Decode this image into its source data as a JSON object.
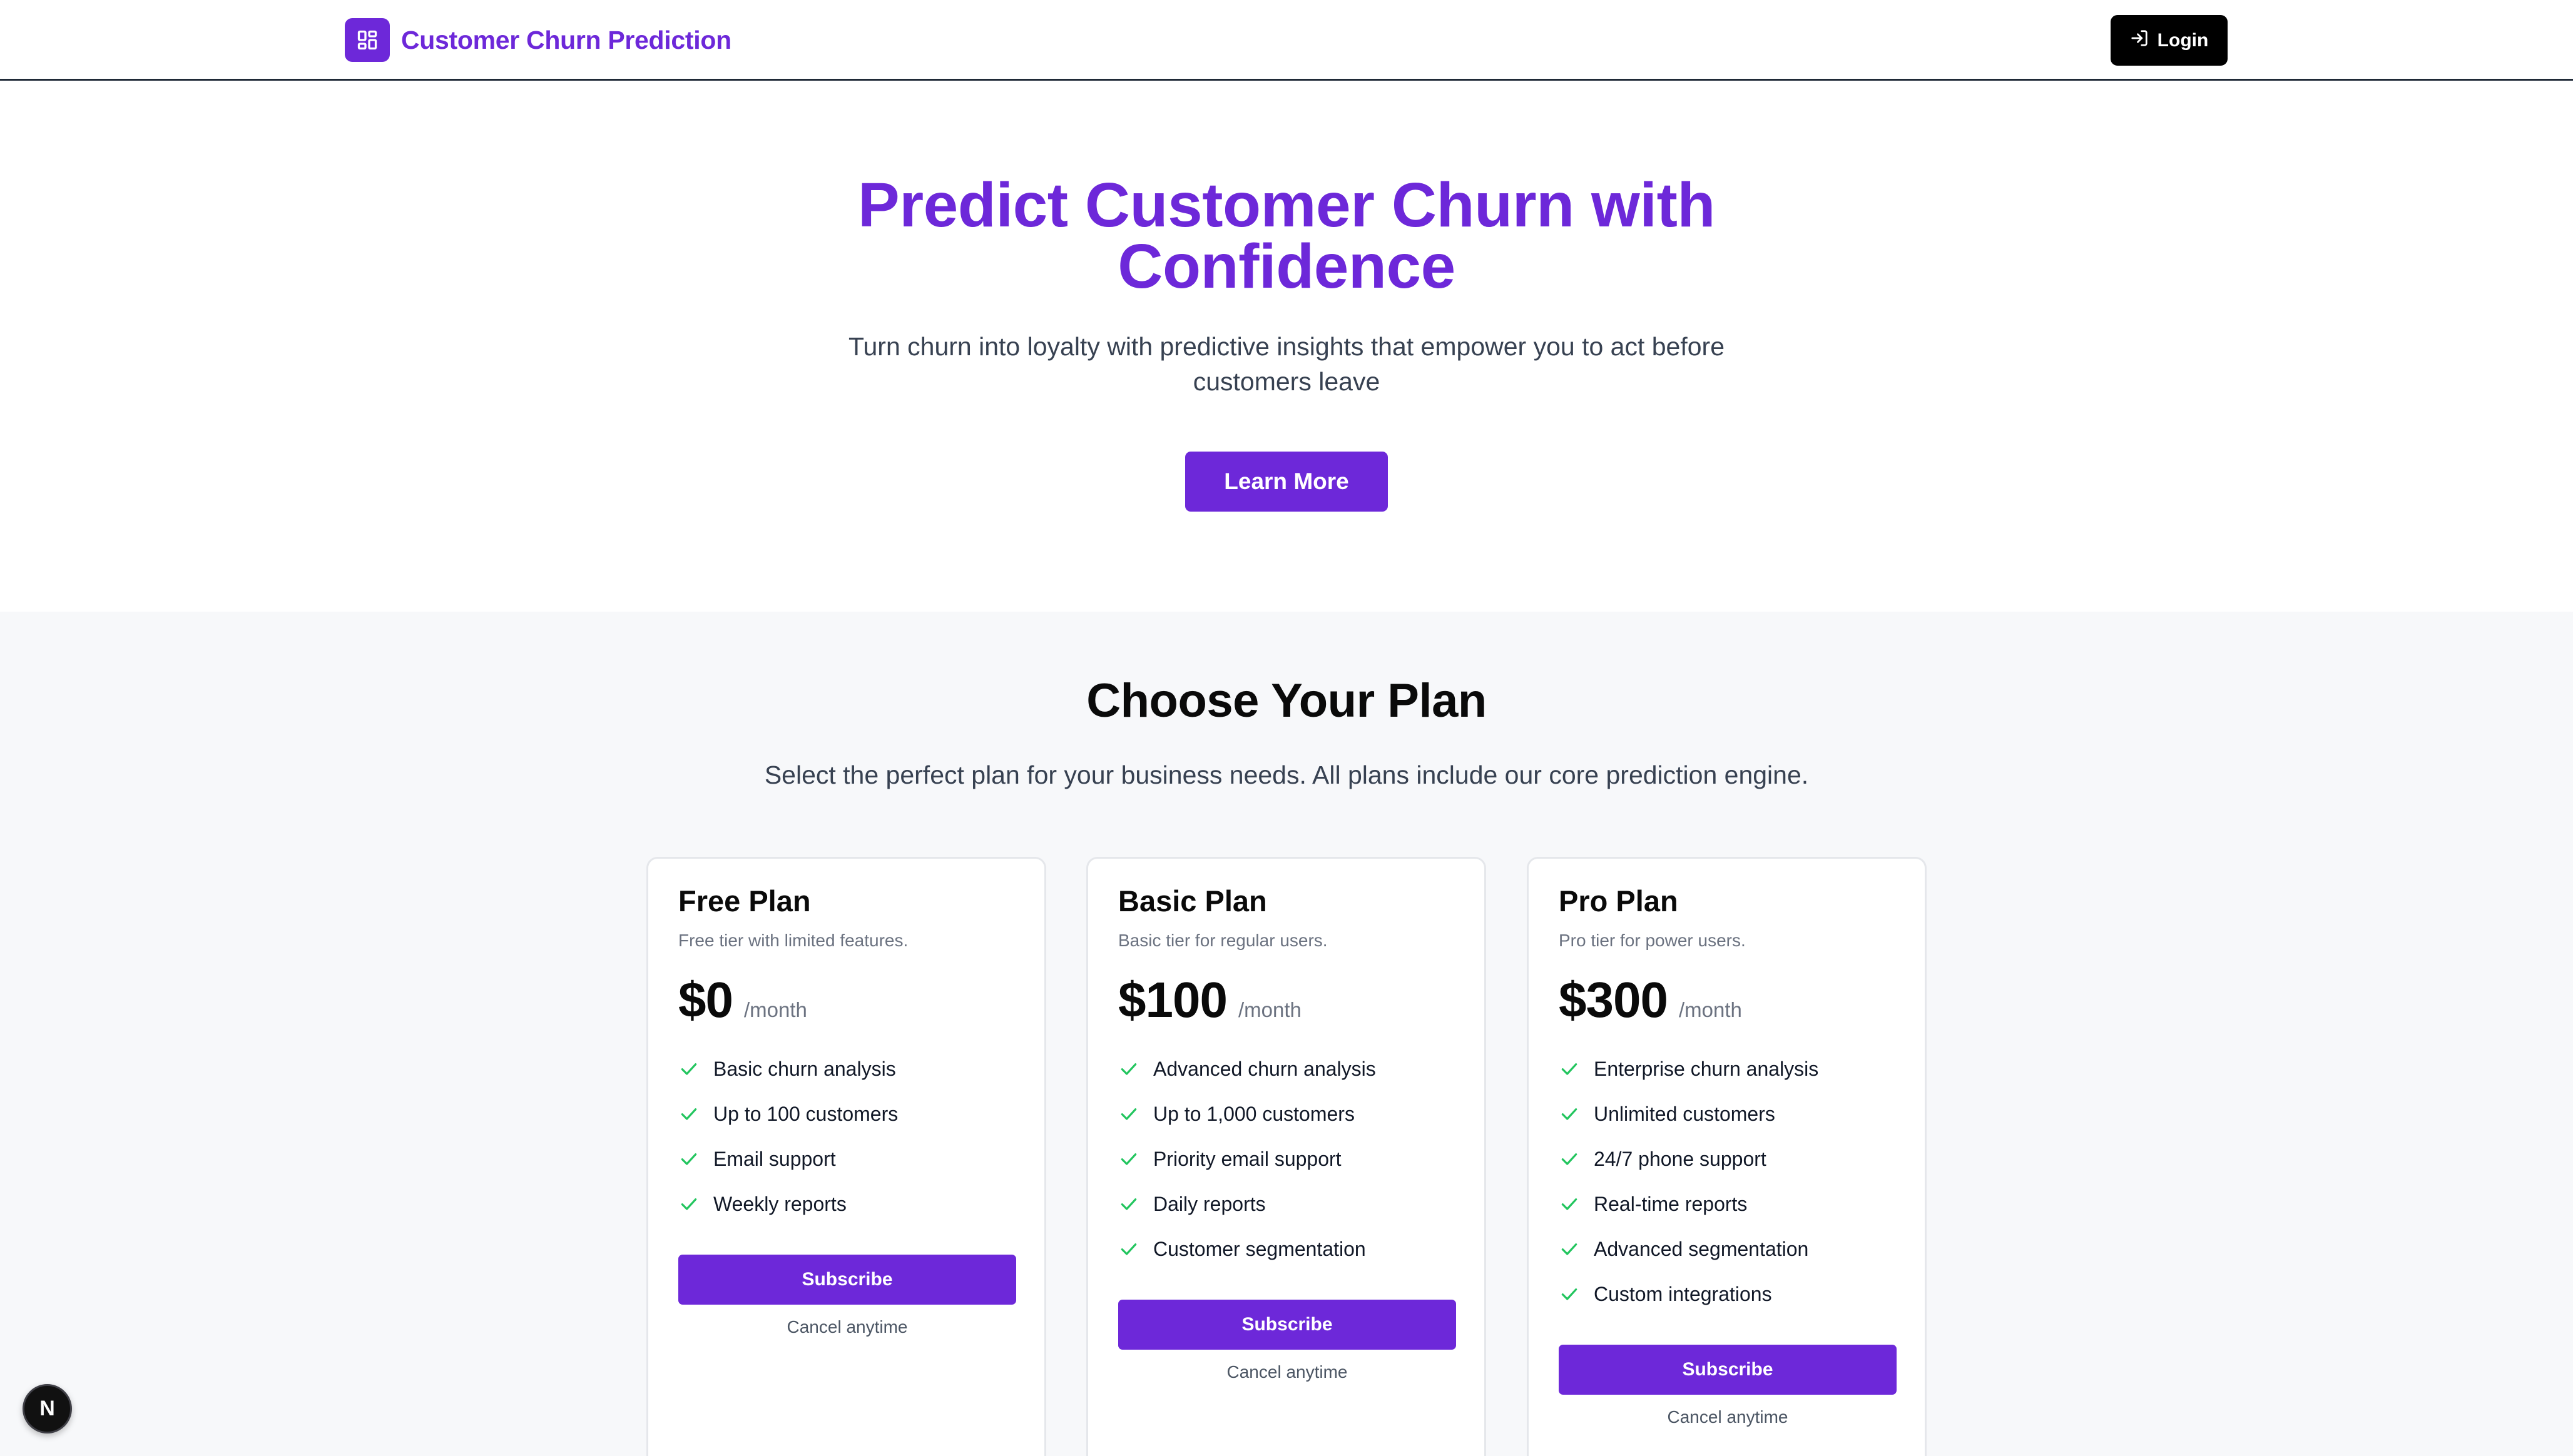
{
  "header": {
    "brand_icon": "dashboard-grid-icon",
    "brand_title": "Customer Churn Prediction",
    "login_icon": "log-in-icon",
    "login_label": "Login"
  },
  "hero": {
    "title": "Predict Customer Churn with Confidence",
    "subtitle": "Turn churn into loyalty with predictive insights that empower you to act before customers leave",
    "cta_label": "Learn More"
  },
  "plans": {
    "title": "Choose Your Plan",
    "subtitle": "Select the perfect plan for your business needs. All plans include our core prediction engine.",
    "items": [
      {
        "name": "Free Plan",
        "description": "Free tier with limited features.",
        "price": "$0",
        "period": "/month",
        "features": [
          "Basic churn analysis",
          "Up to 100 customers",
          "Email support",
          "Weekly reports"
        ],
        "subscribe_label": "Subscribe",
        "cancel_note": "Cancel anytime"
      },
      {
        "name": "Basic Plan",
        "description": "Basic tier for regular users.",
        "price": "$100",
        "period": "/month",
        "features": [
          "Advanced churn analysis",
          "Up to 1,000 customers",
          "Priority email support",
          "Daily reports",
          "Customer segmentation"
        ],
        "subscribe_label": "Subscribe",
        "cancel_note": "Cancel anytime"
      },
      {
        "name": "Pro Plan",
        "description": "Pro tier for power users.",
        "price": "$300",
        "period": "/month",
        "features": [
          "Enterprise churn analysis",
          "Unlimited customers",
          "24/7 phone support",
          "Real-time reports",
          "Advanced segmentation",
          "Custom integrations"
        ],
        "subscribe_label": "Subscribe",
        "cancel_note": "Cancel anytime"
      }
    ]
  },
  "dev_badge": {
    "icon": "nextjs-logo-icon",
    "letter": "N"
  },
  "colors": {
    "brand": "#6d28d9",
    "check": "#22c55e",
    "section_bg": "#f7f8fa"
  }
}
